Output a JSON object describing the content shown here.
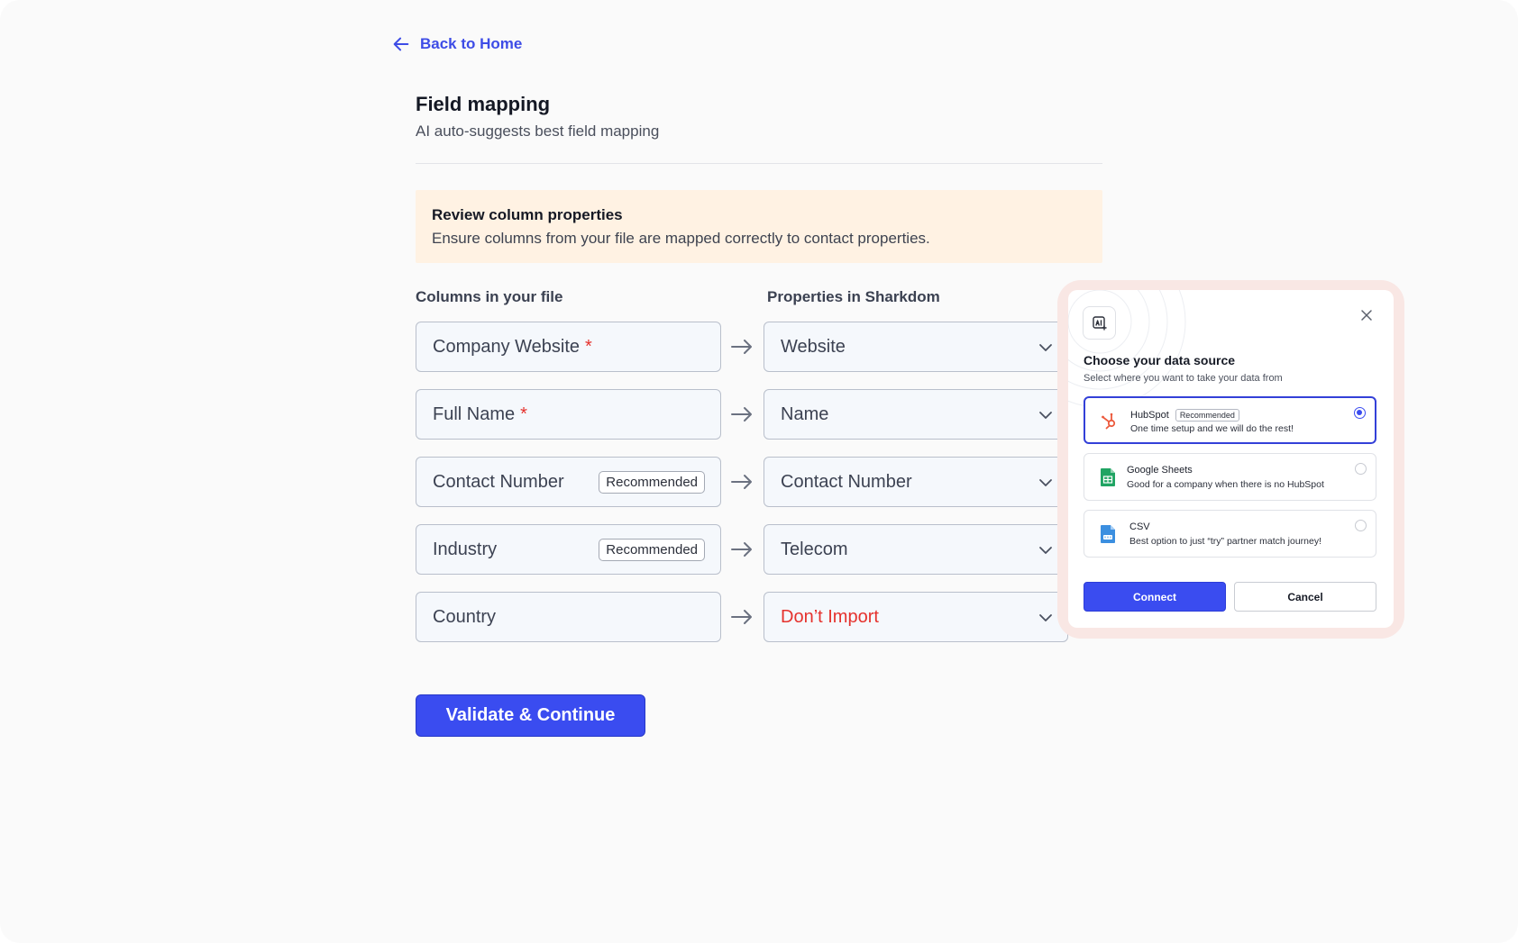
{
  "nav": {
    "back_label": "Back to Home"
  },
  "header": {
    "title": "Field mapping",
    "subtitle": "AI auto-suggests best field mapping"
  },
  "notice": {
    "title": "Review column properties",
    "text": "Ensure columns from your file are mapped correctly to contact properties."
  },
  "mapping": {
    "left_header": "Columns in your file",
    "right_header": "Properties in Sharkdom",
    "rows": [
      {
        "column": "Company Website",
        "required": "*",
        "badge": "",
        "property": "Website"
      },
      {
        "column": "Full Name",
        "required": "*",
        "badge": "",
        "property": "Name"
      },
      {
        "column": "Contact Number",
        "required": "",
        "badge": "Recommended",
        "property": "Contact Number"
      },
      {
        "column": "Industry",
        "required": "",
        "badge": "Recommended",
        "property": "Telecom"
      },
      {
        "column": "Country",
        "required": "",
        "badge": "",
        "property": "Don’t Import"
      }
    ]
  },
  "actions": {
    "primary_label": "Validate & Continue"
  },
  "modal": {
    "title": "Choose your data source",
    "subtitle": "Select where you want to take your data from",
    "options": [
      {
        "name": "HubSpot",
        "badge": "Recommended",
        "description": "One time setup and we will do the rest!",
        "icon": "hubspot-icon",
        "selected": true
      },
      {
        "name": "Google Sheets",
        "badge": "",
        "description": "Good for a company when there is no HubSpot",
        "icon": "google-sheets-icon",
        "selected": false
      },
      {
        "name": "CSV",
        "badge": "",
        "description": "Best option to just “try” partner match journey!",
        "icon": "csv-file-icon",
        "selected": false
      }
    ],
    "connect_label": "Connect",
    "cancel_label": "Cancel"
  },
  "colors": {
    "accent": "#3a4cf0",
    "required": "#e5322d",
    "notice_bg": "#fff2e3",
    "modal_halo": "#f9e7e4"
  }
}
